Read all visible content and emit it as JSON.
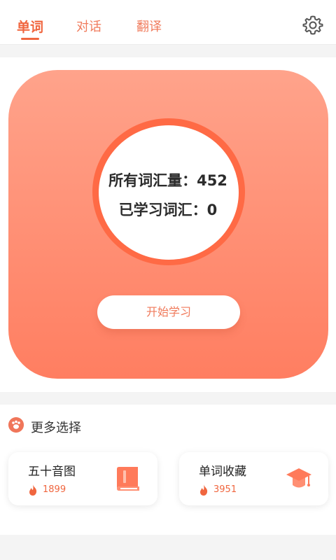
{
  "tabs": [
    {
      "label": "单词",
      "active": true
    },
    {
      "label": "对话",
      "active": false
    },
    {
      "label": "翻译",
      "active": false
    }
  ],
  "hero": {
    "total_vocab": "所有词汇量：452",
    "learned_vocab": "已学习词汇：0",
    "start_button": "开始学习"
  },
  "more": {
    "title": "更多选择",
    "cards": [
      {
        "title": "五十音图",
        "count": "1899",
        "icon": "book-icon"
      },
      {
        "title": "单词收藏",
        "count": "3951",
        "icon": "graduation-cap-icon"
      }
    ]
  },
  "colors": {
    "accent": "#f0663f",
    "hero_top": "#ffa38b",
    "hero_bottom": "#ff7e61"
  }
}
